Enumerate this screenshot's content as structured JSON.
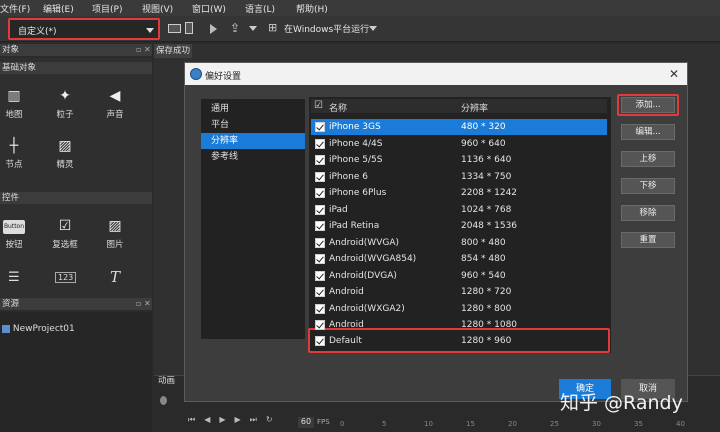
{
  "menu": [
    "文件(F)",
    "编辑(E)",
    "项目(P)",
    "视图(V)",
    "窗口(W)",
    "语言(L)",
    "帮助(H)"
  ],
  "toolbar": {
    "resolution_select": "自定义(*)",
    "run_platform": "在Windows平台运行"
  },
  "editor_tab": "保存成功",
  "left_panel": {
    "objects_header": "对象",
    "basic_section": "基础对象",
    "basic_items": [
      "地图",
      "粒子",
      "声音",
      "节点",
      "精灵"
    ],
    "controls_section": "控件",
    "control_items": [
      "按钮",
      "复选框",
      "图片"
    ],
    "button_preview": "Button",
    "numeric_preview": "123",
    "resources_header": "资源",
    "project_name": "NewProject01"
  },
  "dialog": {
    "title": "偏好设置",
    "nav": [
      "通用",
      "平台",
      "分辨率",
      "参考线"
    ],
    "nav_selected": 2,
    "table_header": {
      "name": "名称",
      "resolution": "分辨率"
    },
    "rows": [
      {
        "name": "iPhone 3GS",
        "res": "480 * 320"
      },
      {
        "name": "iPhone 4/4S",
        "res": "960 * 640"
      },
      {
        "name": "iPhone 5/5S",
        "res": "1136 * 640"
      },
      {
        "name": "iPhone 6",
        "res": "1334 * 750"
      },
      {
        "name": "iPhone 6Plus",
        "res": "2208 * 1242"
      },
      {
        "name": "iPad",
        "res": "1024 * 768"
      },
      {
        "name": "iPad Retina",
        "res": "2048 * 1536"
      },
      {
        "name": "Android(WVGA)",
        "res": "800 * 480"
      },
      {
        "name": "Android(WVGA854)",
        "res": "854 * 480"
      },
      {
        "name": "Android(DVGA)",
        "res": "960 * 540"
      },
      {
        "name": "Android",
        "res": "1280 * 720"
      },
      {
        "name": "Android(WXGA2)",
        "res": "1280 * 800"
      },
      {
        "name": "Android",
        "res": "1280 * 1080"
      },
      {
        "name": "Default",
        "res": "1280 * 960"
      }
    ],
    "buttons": [
      "添加...",
      "编辑...",
      "上移",
      "下移",
      "移除",
      "重置"
    ],
    "ok": "确定",
    "cancel": "取消"
  },
  "timeline": {
    "header": "动画",
    "fps": "60",
    "fps_label": "FPS",
    "ticks": [
      "0",
      "5",
      "10",
      "15",
      "20",
      "25",
      "30",
      "35",
      "40"
    ]
  },
  "watermark": "知乎 @Randy"
}
